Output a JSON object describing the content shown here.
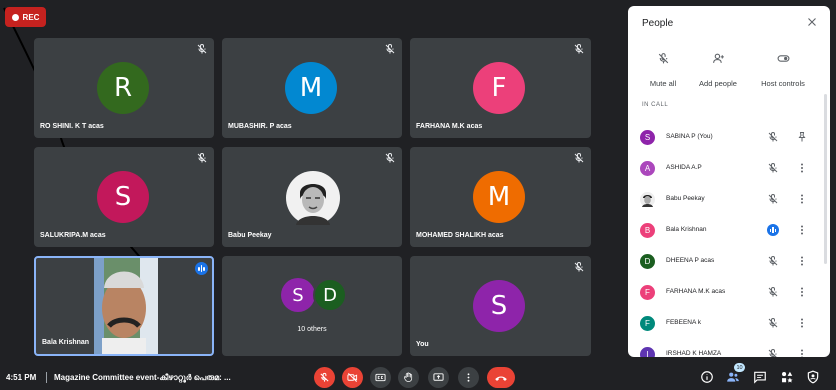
{
  "recording": {
    "label": "REC"
  },
  "tiles": [
    {
      "name": "RO SHINI. K T acas",
      "initial": "R",
      "color": "#33691e",
      "muted": true
    },
    {
      "name": "MUBASHIR. P acas",
      "initial": "M",
      "color": "#0288d1",
      "muted": true
    },
    {
      "name": "FARHANA M.K acas",
      "initial": "F",
      "color": "#ec407a",
      "muted": true
    },
    {
      "name": "SALUKRIPA.M acas",
      "initial": "S",
      "color": "#c2185b",
      "muted": true
    },
    {
      "name": "Babu Peekay",
      "initial": "",
      "color": "#000000",
      "muted": true,
      "photo": true
    },
    {
      "name": "MOHAMED SHALIKH acas",
      "initial": "M",
      "color": "#ef6c00",
      "muted": true
    },
    {
      "name": "Bala Krishnan",
      "initial": "",
      "color": "#1a73e8",
      "speaking": true,
      "video": true
    },
    {
      "name": "10 others",
      "initials": [
        "S",
        "D"
      ],
      "colors": [
        "#8e24aa",
        "#1b5e20"
      ]
    },
    {
      "name": "You",
      "initial": "S",
      "color": "#8e24aa",
      "muted": true
    }
  ],
  "panel": {
    "title": "People",
    "actions": [
      "Mute all",
      "Add people",
      "Host controls"
    ],
    "section": "IN CALL",
    "people": [
      {
        "name": "SABINA P (You)",
        "initial": "S",
        "color": "#8e24aa",
        "right_icon": "pin-icon"
      },
      {
        "name": "ASHIDA A.P",
        "initial": "A",
        "color": "#ab47bc",
        "right_icon": "more-icon"
      },
      {
        "name": "Babu Peekay",
        "initial": "",
        "color": "#000000",
        "right_icon": "more-icon",
        "photo": true
      },
      {
        "name": "Bala Krishnan",
        "initial": "B",
        "color": "#ec407a",
        "right_icon": "more-icon",
        "speaking": true
      },
      {
        "name": "DHEENA P acas",
        "initial": "D",
        "color": "#1b5e20",
        "right_icon": "more-icon"
      },
      {
        "name": "FARHANA M.K acas",
        "initial": "F",
        "color": "#ec407a",
        "right_icon": "more-icon"
      },
      {
        "name": "FEBEENA k",
        "initial": "F",
        "color": "#00897b",
        "right_icon": "more-icon"
      },
      {
        "name": "IRSHAD K HAMZA",
        "initial": "I",
        "color": "#5e35b1",
        "right_icon": "more-icon"
      }
    ]
  },
  "bottom": {
    "time": "4:51 PM",
    "meeting": "Magazine Committee event-കീഴാറ്റൂർ പെരുമ: ...",
    "participant_count": "10"
  }
}
